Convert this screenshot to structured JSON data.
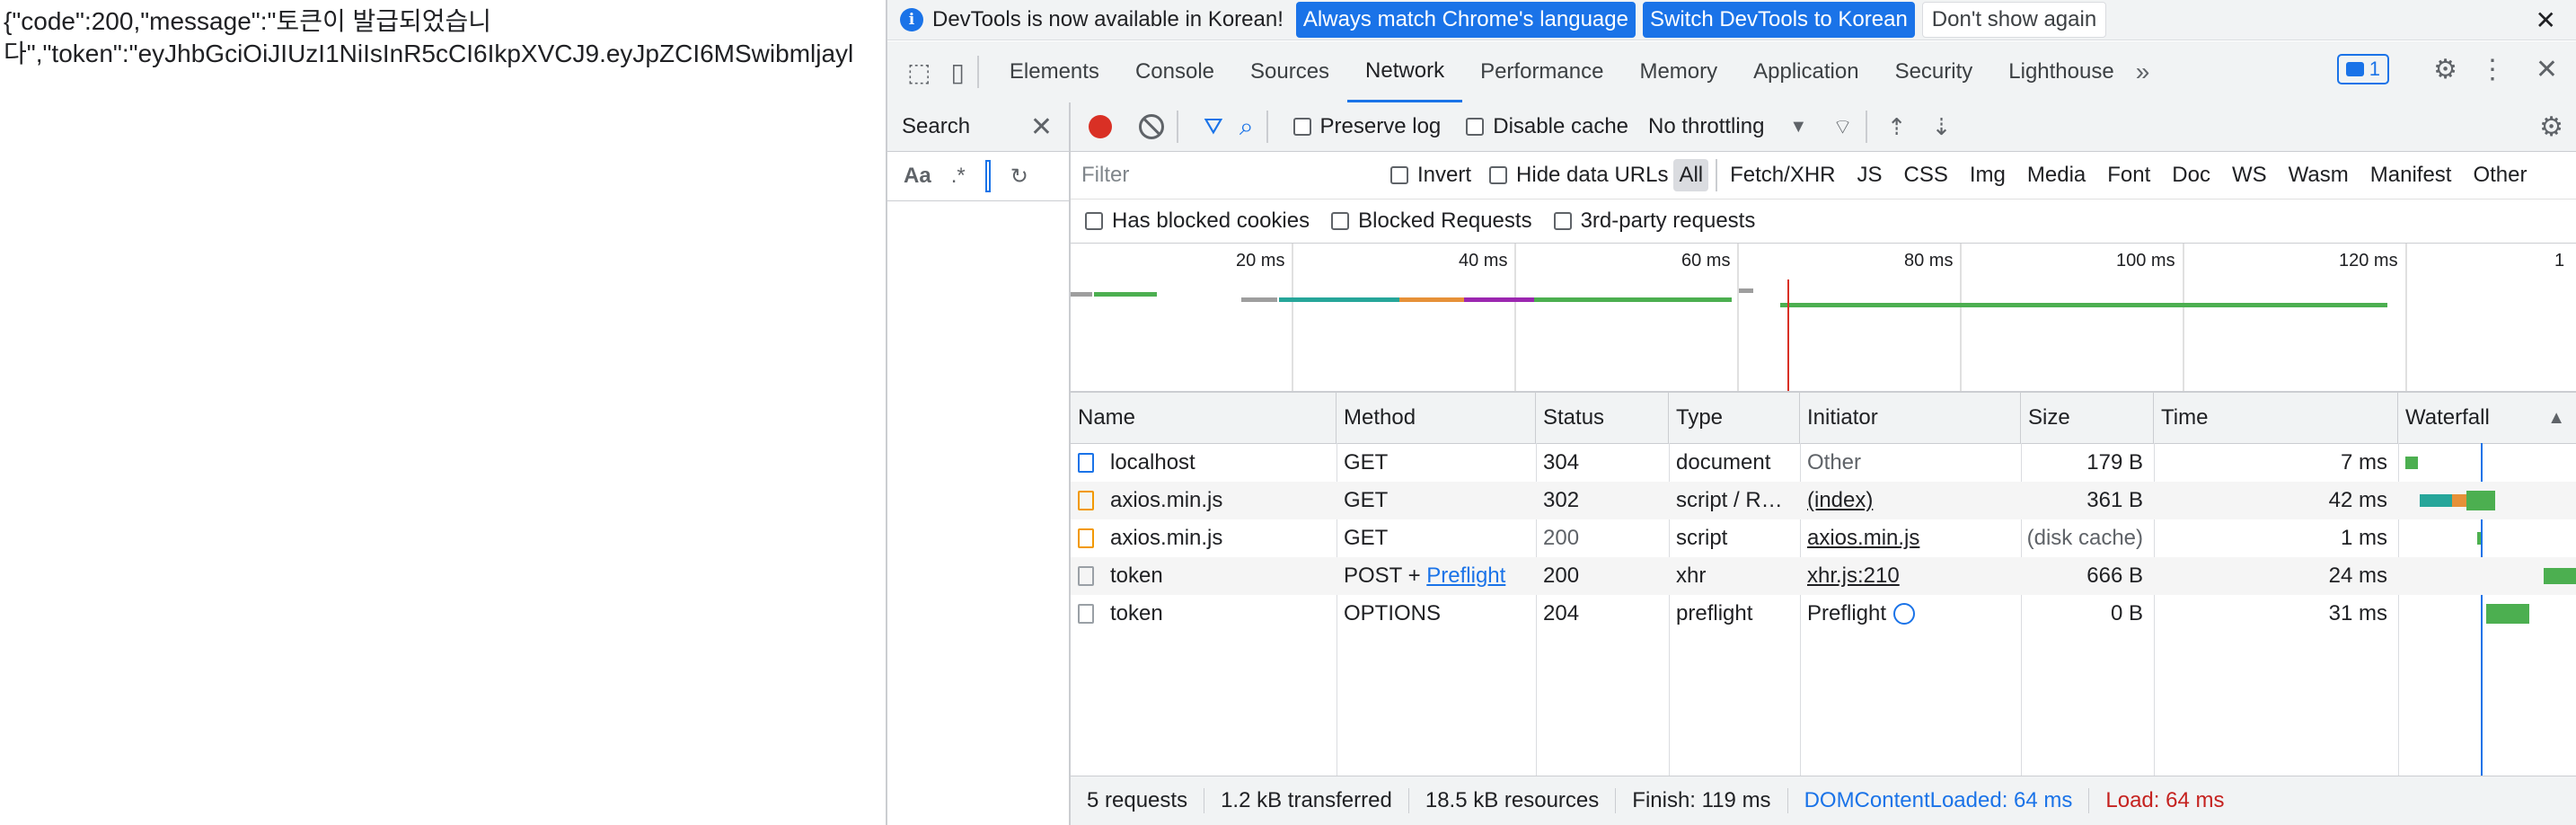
{
  "page": {
    "line1": "{\"code\":200,\"message\":\"토큰이 발급되었습니",
    "line2": "다\",\"token\":\"eyJhbGciOiJIUzI1NiIsInR5cCI6IkpXVCJ9.eyJpZCI6MSwibmljayl"
  },
  "infobar": {
    "message": "DevTools is now available in Korean!",
    "btn_match": "Always match Chrome's language",
    "btn_switch": "Switch DevTools to Korean",
    "btn_dismiss": "Don't show again",
    "close": "✕"
  },
  "tabs": [
    "Elements",
    "Console",
    "Sources",
    "Network",
    "Performance",
    "Memory",
    "Application",
    "Security",
    "Lighthouse"
  ],
  "active_tab": "Network",
  "issues_count": "1",
  "search_panel": {
    "title": "Search",
    "case_label": "Aa",
    "regex_label": ".*"
  },
  "toolbar": {
    "preserve_log": "Preserve log",
    "disable_cache": "Disable cache",
    "throttling": "No throttling"
  },
  "filter": {
    "placeholder": "Filter",
    "invert": "Invert",
    "hide_data_urls": "Hide data URLs",
    "types": [
      "All",
      "Fetch/XHR",
      "JS",
      "CSS",
      "Img",
      "Media",
      "Font",
      "Doc",
      "WS",
      "Wasm",
      "Manifest",
      "Other"
    ],
    "blocked_cookies": "Has blocked cookies",
    "blocked_requests": "Blocked Requests",
    "third_party": "3rd-party requests"
  },
  "overview": {
    "ticks": [
      "20 ms",
      "40 ms",
      "60 ms",
      "80 ms",
      "100 ms",
      "120 ms",
      "1"
    ]
  },
  "columns": [
    "Name",
    "Method",
    "Status",
    "Type",
    "Initiator",
    "Size",
    "Time",
    "Waterfall"
  ],
  "rows": [
    {
      "name": "localhost",
      "method": "GET",
      "status": "304",
      "type": "document",
      "initiator": "Other",
      "size": "179 B",
      "time": "7 ms"
    },
    {
      "name": "axios.min.js",
      "method": "GET",
      "status": "302",
      "type": "script / R…",
      "initiator": "(index)",
      "size": "361 B",
      "time": "42 ms"
    },
    {
      "name": "axios.min.js",
      "method": "GET",
      "status": "200",
      "type": "script",
      "initiator": "axios.min.js",
      "size": "(disk cache)",
      "time": "1 ms"
    },
    {
      "name": "token",
      "method": "POST + ",
      "method_link": "Preflight",
      "status": "200",
      "type": "xhr",
      "initiator": "xhr.js:210",
      "size": "666 B",
      "time": "24 ms"
    },
    {
      "name": "token",
      "method": "OPTIONS",
      "status": "204",
      "type": "preflight",
      "initiator": "Preflight",
      "size": "0 B",
      "time": "31 ms"
    }
  ],
  "status_bar": {
    "requests": "5 requests",
    "transferred": "1.2 kB transferred",
    "resources": "18.5 kB resources",
    "finish": "Finish: 119 ms",
    "dcl": "DOMContentLoaded: 64 ms",
    "load": "Load: 64 ms"
  },
  "colors": {
    "accent": "#1a73e8",
    "record": "#d93025",
    "load": "#c5221f",
    "bar_green": "#4caf50"
  }
}
